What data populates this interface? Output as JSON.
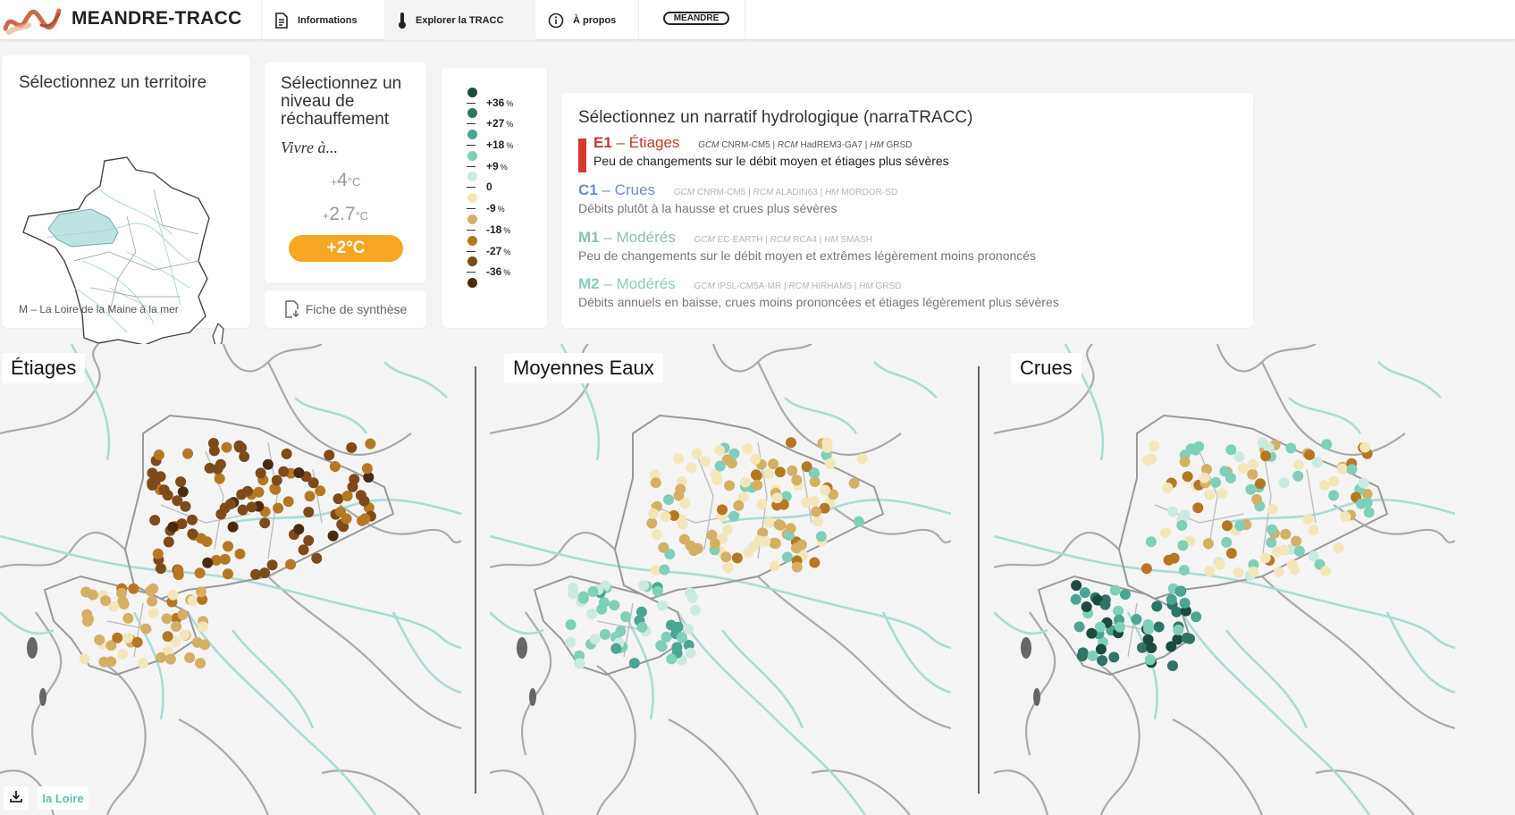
{
  "header": {
    "brand": "MEANDRE-TRACC",
    "nav": [
      {
        "label": "Informations",
        "icon": "document-icon"
      },
      {
        "label": "Explorer la TRACC",
        "icon": "thermometer-icon"
      },
      {
        "label": "À propos",
        "icon": "info-icon"
      }
    ],
    "meandre_label": "MEANDRE"
  },
  "territory": {
    "title": "Sélectionnez un territoire",
    "selected": "M – La Loire de la Maine à la mer"
  },
  "warming": {
    "title": "Sélectionnez un niveau de réchauffement",
    "subtitle": "Vivre à...",
    "options": [
      {
        "sign": "+",
        "value": "4",
        "unit": "°C"
      },
      {
        "sign": "+",
        "value": "2.7",
        "unit": "°C"
      }
    ],
    "selected": "+2°C",
    "fiche_label": "Fiche de synthèse"
  },
  "legend": {
    "entries": [
      "+36",
      "+27",
      "+18",
      "+9",
      "0",
      "-9",
      "-18",
      "-27",
      "-36"
    ],
    "unit": "%",
    "colors": [
      "#1b4a3f",
      "#2f7467",
      "#4aa593",
      "#7fcfb9",
      "#cbeae0",
      "#f4e6bb",
      "#d3b064",
      "#b57822",
      "#7d4a1a",
      "#4a2a10"
    ]
  },
  "narratives": {
    "title": "Sélectionnez un narratif hydrologique (narraTRACC)",
    "items": [
      {
        "code": "E1",
        "name": "Étiages",
        "gcm": "CNRM-CM5",
        "rcm": "HadREM3-GA7",
        "hm": "GRSD",
        "desc": "Peu de changements sur le débit moyen et étiages plus sévères",
        "color": "#c0392b"
      },
      {
        "code": "C1",
        "name": "Crues",
        "gcm": "CNRM-CM5",
        "rcm": "ALADIN63",
        "hm": "MORDOR-SD",
        "desc": "Débits plutôt à la hausse et crues plus sévères",
        "color": "#6f8cc4"
      },
      {
        "code": "M1",
        "name": "Modérés",
        "gcm": "EC-EARTH",
        "rcm": "RCA4",
        "hm": "SMASH",
        "desc": "Peu de changements sur le débit moyen et extrêmes légèrement moins prononcés",
        "color": "#8ebfaa"
      },
      {
        "code": "M2",
        "name": "Modérés",
        "gcm": "IPSL-CM5A-MR",
        "rcm": "HIRHAM5",
        "hm": "GRSD",
        "desc": "Débits annuels en baisse, crues moins prononcées et étiages légèrement plus sévères",
        "color": "#88ccbd"
      }
    ],
    "labels": {
      "dash": "–",
      "gcm": "GCM",
      "rcm": "RCM",
      "hm": "HM",
      "sep": "|"
    }
  },
  "maps": [
    {
      "title": "Étiages",
      "palette": "brown"
    },
    {
      "title": "Moyennes Eaux",
      "palette": "mixed"
    },
    {
      "title": "Crues",
      "palette": "green"
    }
  ],
  "footer": {
    "river_label": "la Loire",
    "download_icon": "download-icon"
  }
}
